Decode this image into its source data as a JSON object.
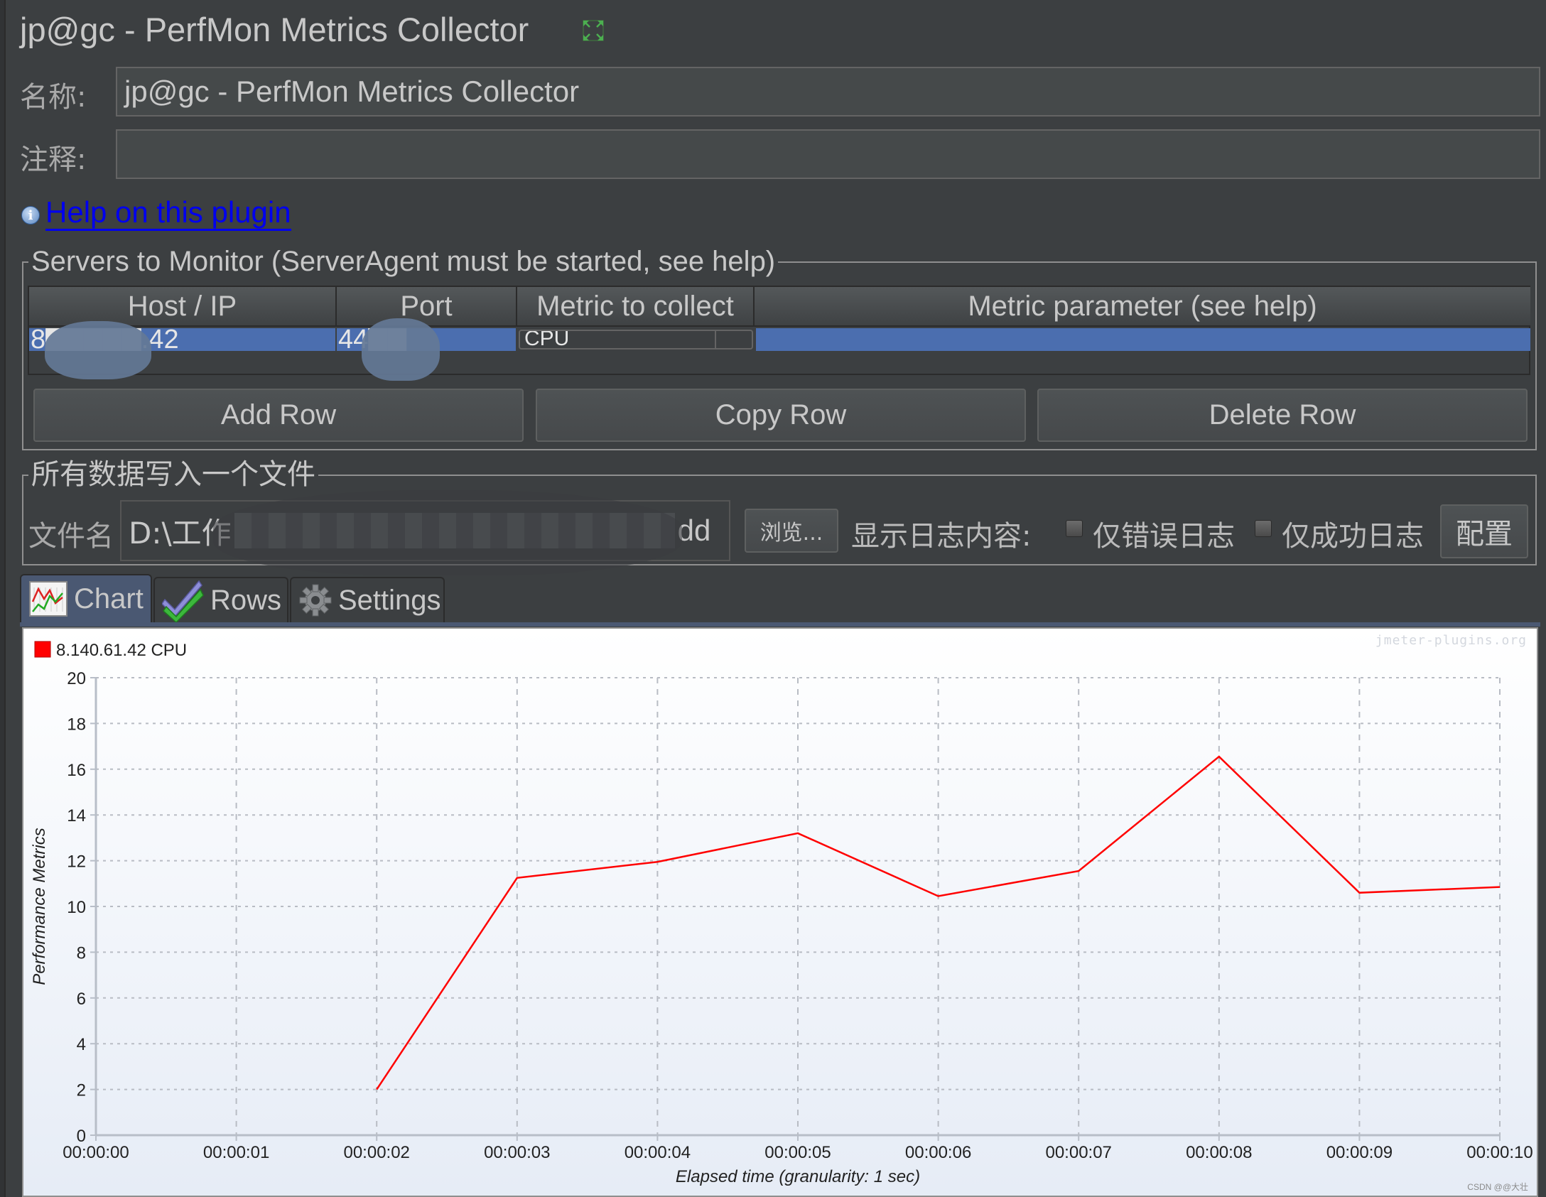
{
  "window": {
    "title": "jp@gc - PerfMon Metrics Collector"
  },
  "form": {
    "name_label": "名称:",
    "name_value": "jp@gc - PerfMon Metrics Collector",
    "comment_label": "注释:",
    "comment_value": ""
  },
  "help": {
    "link_text": "Help on this plugin"
  },
  "servers": {
    "group_title": "Servers to Monitor (ServerAgent must be started, see help)",
    "columns": [
      "Host / IP",
      "Port",
      "Metric to collect",
      "Metric parameter (see help)"
    ],
    "rows": [
      {
        "host": "8█████.42",
        "port": "44██",
        "metric": "CPU",
        "parameter": ""
      }
    ],
    "buttons": {
      "add": "Add Row",
      "copy": "Copy Row",
      "delete": "Delete Row"
    }
  },
  "file": {
    "group_title": "所有数据写入一个文件",
    "filename_label": "文件名",
    "filename_value_prefix": "D:\\工作",
    "filename_value_suffix": "dd",
    "browse_label": "浏览...",
    "log_label": "显示日志内容:",
    "errors_only_label": "仅错误日志",
    "errors_only_checked": false,
    "success_only_label": "仅成功日志",
    "success_only_checked": false,
    "configure_label": "配置"
  },
  "tabs": [
    {
      "label": "Chart",
      "icon": "line-chart-icon",
      "active": true
    },
    {
      "label": "Rows",
      "icon": "checkmark-icon",
      "active": false
    },
    {
      "label": "Settings",
      "icon": "gear-icon",
      "active": false
    }
  ],
  "watermark": "jmeter-plugins.org",
  "credit": "CSDN @@大壮",
  "colors": {
    "series": "#ff0000",
    "selection": "#4b6eaf",
    "link": "#0000ee"
  },
  "chart_data": {
    "type": "line",
    "title": "",
    "xlabel": "Elapsed time (granularity: 1 sec)",
    "ylabel": "Performance Metrics",
    "x": [
      "00:00:00",
      "00:00:01",
      "00:00:02",
      "00:00:03",
      "00:00:04",
      "00:00:05",
      "00:00:06",
      "00:00:07",
      "00:00:08",
      "00:00:09",
      "00:00:10"
    ],
    "xlim_seconds": [
      0,
      10
    ],
    "ylim": [
      0,
      20
    ],
    "yticks": [
      0,
      2,
      4,
      6,
      8,
      10,
      12,
      14,
      16,
      18,
      20
    ],
    "grid": true,
    "legend_position": "top-left",
    "series": [
      {
        "name": "8.140.61.42 CPU",
        "color": "#ff0000",
        "points": [
          {
            "t": 2,
            "value": 2.0
          },
          {
            "t": 3,
            "value": 11.25
          },
          {
            "t": 4,
            "value": 11.95
          },
          {
            "t": 5,
            "value": 13.2
          },
          {
            "t": 6,
            "value": 10.45
          },
          {
            "t": 7,
            "value": 11.55
          },
          {
            "t": 8,
            "value": 16.55
          },
          {
            "t": 9,
            "value": 10.6
          },
          {
            "t": 10,
            "value": 10.85
          }
        ]
      }
    ]
  }
}
